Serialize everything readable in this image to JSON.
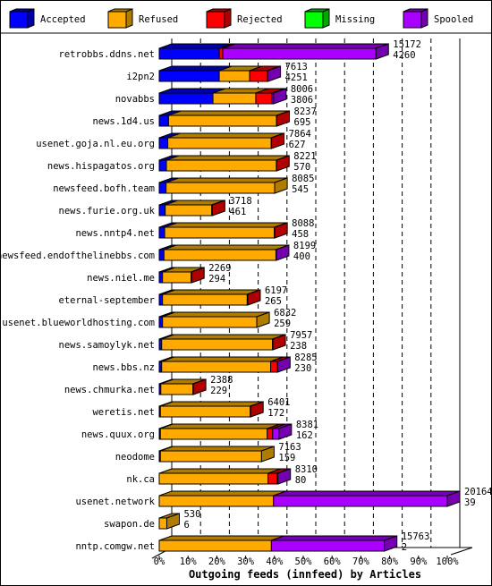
{
  "chart_data": {
    "type": "bar",
    "orientation": "horizontal",
    "stacked": true,
    "style": "3d",
    "xlabel": "Outgoing feeds (innfeed) by Articles",
    "x_ticks": [
      "0%",
      "10%",
      "20%",
      "30%",
      "40%",
      "50%",
      "60%",
      "70%",
      "80%",
      "90%",
      "100%"
    ],
    "xlim": [
      0,
      100
    ],
    "grid": true,
    "legend_position": "top",
    "series": [
      {
        "name": "Accepted",
        "color": "#0000ff",
        "side": "#0000a8"
      },
      {
        "name": "Refused",
        "color": "#ffaa00",
        "side": "#b07c00"
      },
      {
        "name": "Rejected",
        "color": "#ff0000",
        "side": "#b00000"
      },
      {
        "name": "Missing",
        "color": "#00ff00",
        "side": "#00a800"
      },
      {
        "name": "Spooled",
        "color": "#aa00ff",
        "side": "#7400b0"
      }
    ],
    "rows": [
      {
        "label": "retrobbs.ddns.net",
        "total": "15172",
        "second": "4260",
        "values": [
          4200,
          0,
          250,
          0,
          10722
        ]
      },
      {
        "label": "i2pn2",
        "total": "7613",
        "second": "4251",
        "values": [
          4200,
          2130,
          1250,
          0,
          33
        ]
      },
      {
        "label": "novabbs",
        "total": "8006",
        "second": "3806",
        "values": [
          3760,
          3000,
          1130,
          0,
          116
        ]
      },
      {
        "label": "news.1d4.us",
        "total": "8237",
        "second": "695",
        "values": [
          650,
          7560,
          27,
          0,
          0
        ]
      },
      {
        "label": "usenet.goja.nl.eu.org",
        "total": "7864",
        "second": "627",
        "values": [
          600,
          7240,
          24,
          0,
          0
        ]
      },
      {
        "label": "news.hispagatos.org",
        "total": "8221",
        "second": "570",
        "values": [
          500,
          7700,
          21,
          0,
          0
        ]
      },
      {
        "label": "newsfeed.bofh.team",
        "total": "8085",
        "second": "545",
        "values": [
          480,
          7605,
          0,
          0,
          0
        ]
      },
      {
        "label": "news.furie.org.uk",
        "total": "3718",
        "second": "461",
        "values": [
          420,
          3260,
          38,
          0,
          0
        ]
      },
      {
        "label": "news.nntp4.net",
        "total": "8088",
        "second": "458",
        "values": [
          380,
          7680,
          28,
          0,
          0
        ]
      },
      {
        "label": "newsfeed.endofthelinebbs.com",
        "total": "8199",
        "second": "400",
        "values": [
          330,
          7840,
          0,
          0,
          29
        ]
      },
      {
        "label": "news.niel.me",
        "total": "2269",
        "second": "294",
        "values": [
          230,
          2000,
          39,
          0,
          0
        ]
      },
      {
        "label": "eternal-september",
        "total": "6197",
        "second": "265",
        "values": [
          230,
          5930,
          37,
          0,
          0
        ]
      },
      {
        "label": "usenet.blueworldhosting.com",
        "total": "6832",
        "second": "259",
        "values": [
          230,
          6602,
          0,
          0,
          0
        ]
      },
      {
        "label": "news.samoylyk.net",
        "total": "7957",
        "second": "238",
        "values": [
          170,
          7760,
          27,
          0,
          0
        ]
      },
      {
        "label": "news.bbs.nz",
        "total": "8285",
        "second": "230",
        "values": [
          170,
          7630,
          480,
          0,
          5
        ]
      },
      {
        "label": "news.chmurka.net",
        "total": "2388",
        "second": "229",
        "values": [
          110,
          2250,
          28,
          0,
          0
        ]
      },
      {
        "label": "weretis.net",
        "total": "6401",
        "second": "172",
        "values": [
          80,
          6290,
          31,
          0,
          0
        ]
      },
      {
        "label": "news.quux.org",
        "total": "8381",
        "second": "162",
        "values": [
          80,
          7481,
          380,
          0,
          440
        ]
      },
      {
        "label": "neodome",
        "total": "7163",
        "second": "159",
        "values": [
          80,
          7083,
          0,
          0,
          0
        ]
      },
      {
        "label": "nk.ca",
        "total": "8310",
        "second": "80",
        "values": [
          0,
          7620,
          630,
          0,
          60
        ]
      },
      {
        "label": "usenet.network",
        "total": "20164",
        "second": "39",
        "values": [
          0,
          8000,
          0,
          0,
          12164
        ]
      },
      {
        "label": "swapon.de",
        "total": "530",
        "second": "6",
        "values": [
          0,
          530,
          0,
          0,
          0
        ]
      },
      {
        "label": "nntp.comgw.net",
        "total": "15763",
        "second": "2",
        "values": [
          0,
          7850,
          0,
          0,
          7913
        ]
      }
    ]
  }
}
